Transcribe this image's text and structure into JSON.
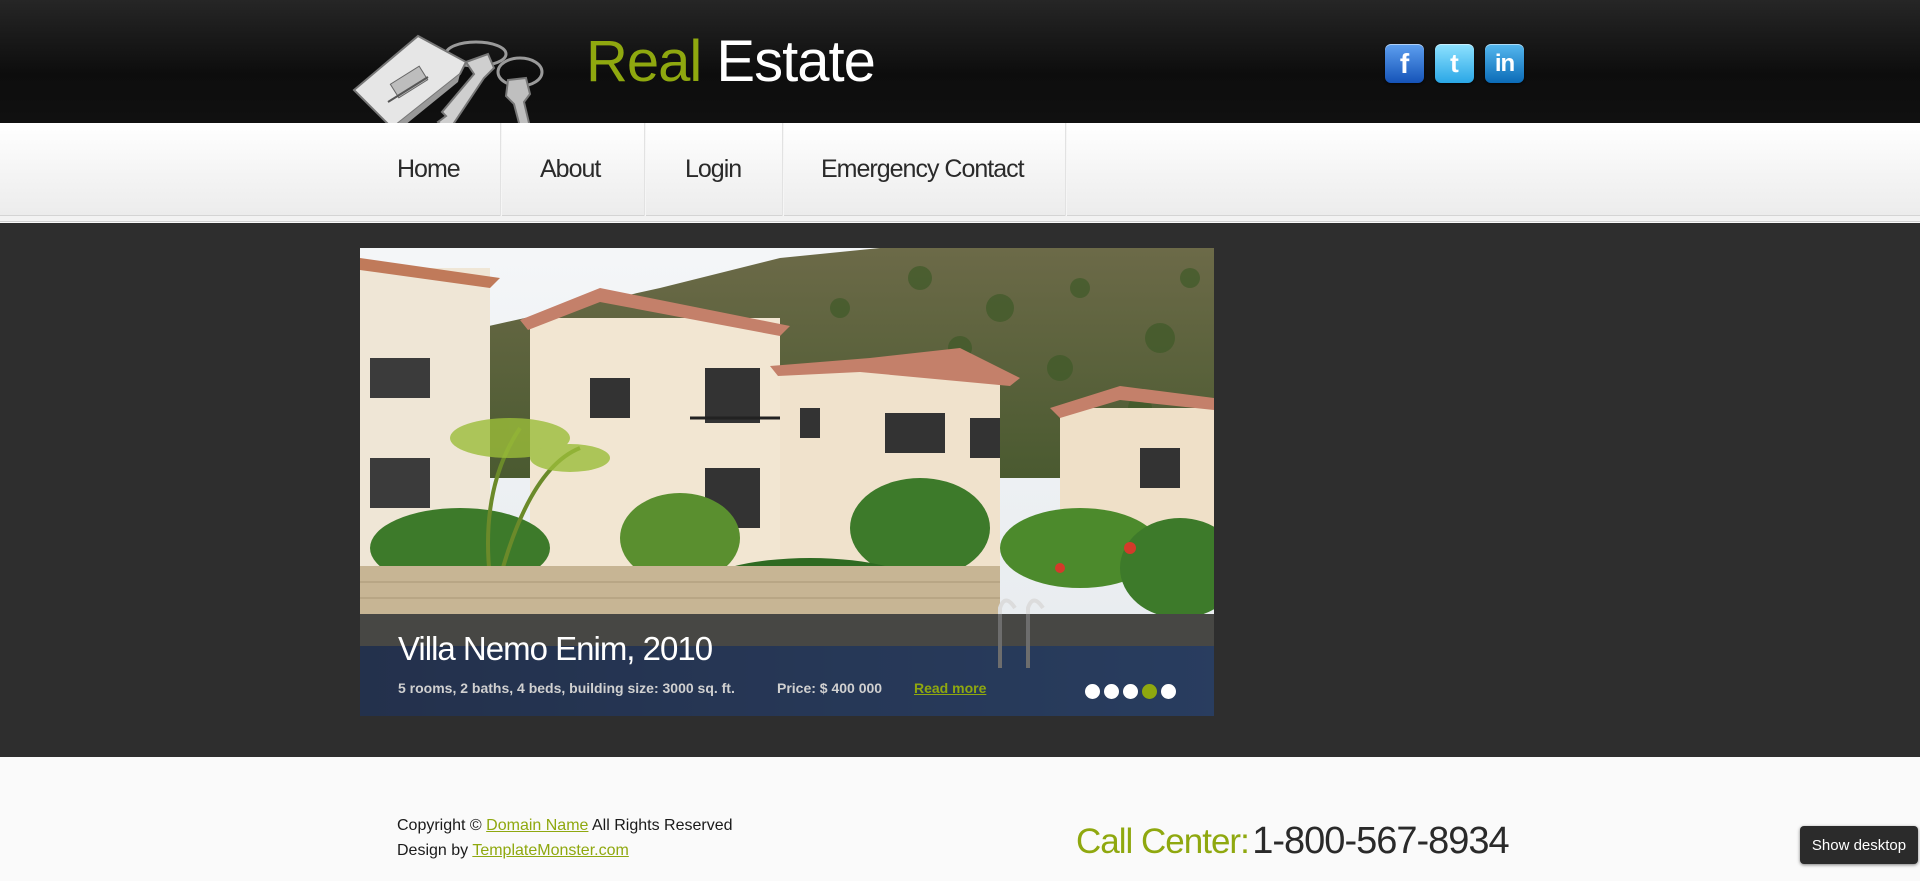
{
  "header": {
    "logo_word1": "Real",
    "logo_word2": "Estate",
    "social": [
      "facebook-icon",
      "twitter-icon",
      "linkedin-icon"
    ]
  },
  "nav": {
    "items": [
      {
        "label": "Home"
      },
      {
        "label": "About"
      },
      {
        "label": "Login"
      },
      {
        "label": "Emergency Contact"
      }
    ]
  },
  "slider": {
    "title": "Villa Nemo Enim, 2010",
    "details": "5 rooms, 2 baths, 4 beds, building size: 3000 sq. ft.",
    "price": "Price: $ 400 000",
    "read_more": "Read more",
    "slide_count": 5,
    "active_slide": 4
  },
  "footer": {
    "copyright_prefix": "Copyright ©",
    "domain_link": "Domain Name",
    "copyright_suffix": "All Rights Reserved",
    "design_prefix": "Design by",
    "design_link": "TemplateMonster.com",
    "call_label": "Call Center:",
    "call_number": "1-800-567-8934"
  },
  "tooltip": {
    "show_desktop": "Show desktop"
  },
  "colors": {
    "accent": "#8fa80f",
    "header_bg": "#111111",
    "main_bg": "#2e2e2e"
  }
}
